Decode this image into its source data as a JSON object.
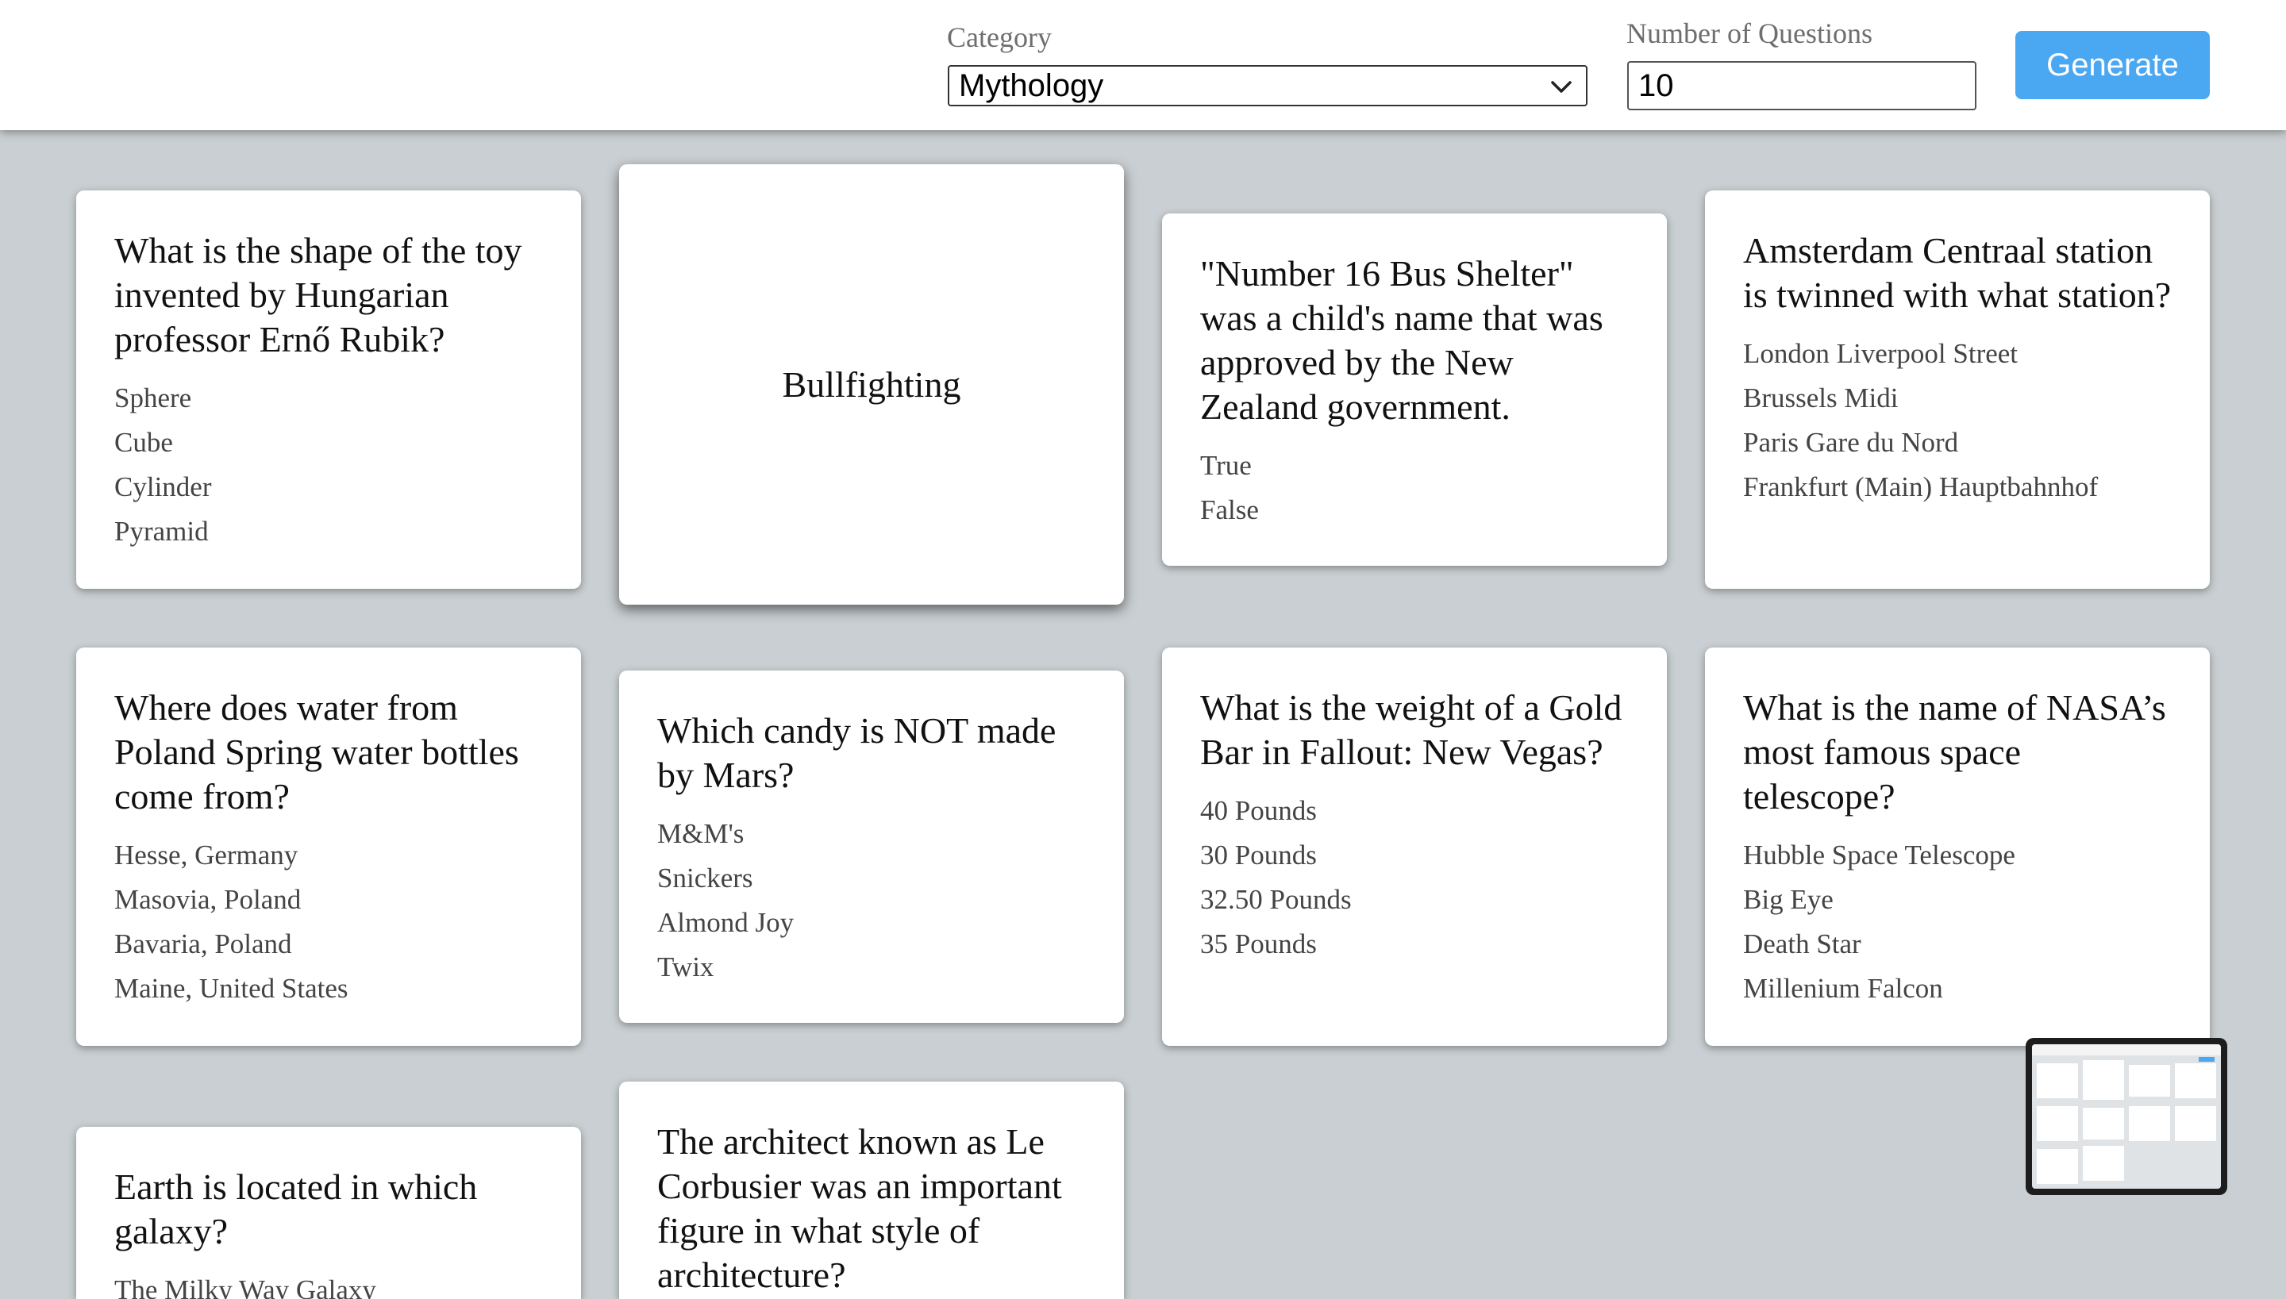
{
  "header": {
    "category_label": "Category",
    "category_value": "Mythology",
    "count_label": "Number of Questions",
    "count_value": "10",
    "generate_label": "Generate"
  },
  "cards": [
    {
      "question": "What is the shape of the toy invented by Hungarian professor Ernő Rubik?",
      "options": [
        "Sphere",
        "Cube",
        "Cylinder",
        "Pyramid"
      ]
    },
    {
      "answer": "Bullfighting"
    },
    {
      "question": "\"Number 16 Bus Shelter\" was a child's name that was approved by the New Zealand government.",
      "options": [
        "True",
        "False"
      ]
    },
    {
      "question": "Amsterdam Centraal station is twinned with what station?",
      "options": [
        "London Liverpool Street",
        "Brussels Midi",
        "Paris Gare du Nord",
        "Frankfurt (Main) Hauptbahnhof"
      ]
    },
    {
      "question": "Where does water from Poland Spring water bottles come from?",
      "options": [
        "Hesse, Germany",
        "Masovia, Poland",
        "Bavaria, Poland",
        "Maine, United States"
      ]
    },
    {
      "question": "Which candy is NOT made by Mars?",
      "options": [
        "M&M's",
        "Snickers",
        "Almond Joy",
        "Twix"
      ]
    },
    {
      "question": "What is the weight of a Gold Bar in Fallout: New Vegas?",
      "options": [
        "40 Pounds",
        "30 Pounds",
        "32.50 Pounds",
        "35 Pounds"
      ]
    },
    {
      "question": "What is the name of NASA’s most famous space telescope?",
      "options": [
        "Hubble Space Telescope",
        "Big Eye",
        "Death Star",
        "Millenium Falcon"
      ]
    },
    {
      "question": "Earth is located in which galaxy?",
      "options": [
        "The Milky Way Galaxy"
      ]
    },
    {
      "question": "The architect known as Le Corbusier was an important figure in what style of architecture?",
      "options": []
    }
  ]
}
